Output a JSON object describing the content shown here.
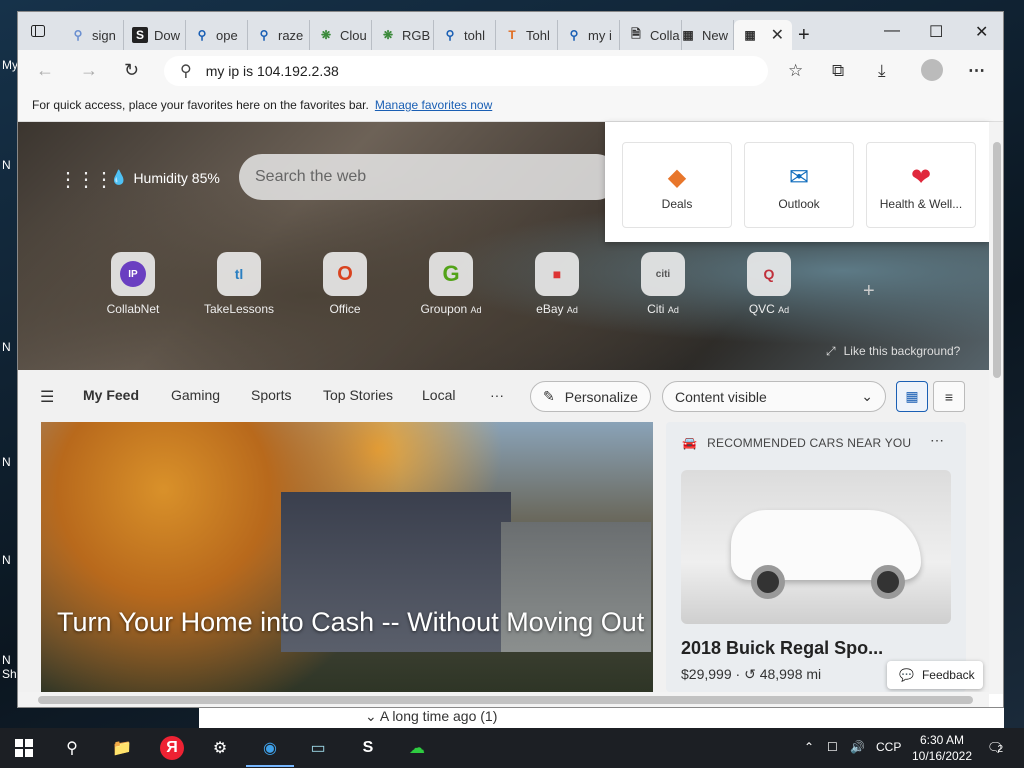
{
  "desktop": {
    "fragments": [
      "My",
      "N",
      "N",
      "N",
      "N",
      "N",
      "Sh"
    ]
  },
  "tabs": [
    {
      "label": "sign",
      "icon": "search-icon"
    },
    {
      "label": "Dow",
      "icon": "sharex-icon"
    },
    {
      "label": "ope",
      "icon": "search-icon"
    },
    {
      "label": "raze",
      "icon": "search-icon"
    },
    {
      "label": "Clou",
      "icon": "leaf-icon"
    },
    {
      "label": "RGB",
      "icon": "leaf-icon"
    },
    {
      "label": "tohl",
      "icon": "search-icon"
    },
    {
      "label": "Tohl",
      "icon": "t-logo-icon"
    },
    {
      "label": "my i",
      "icon": "search-icon"
    },
    {
      "label": "Colla",
      "icon": "page-icon"
    },
    {
      "label": "New",
      "icon": "newtab-icon"
    }
  ],
  "active_tab": {
    "icon": "newtab-icon"
  },
  "address_bar": {
    "value": "my ip is 104.192.2.38"
  },
  "favbar": {
    "text": "For quick access, place your favorites here on the favorites bar.",
    "link": "Manage favorites now"
  },
  "newtab": {
    "weather": "Humidity 85%",
    "search_placeholder": "Search the web",
    "quick_links": [
      {
        "label": "CollabNet",
        "glyph": "IP"
      },
      {
        "label": "TakeLessons",
        "glyph": "tl"
      },
      {
        "label": "Office",
        "glyph": "O"
      },
      {
        "label": "Groupon",
        "glyph": "G",
        "ad": "Ad"
      },
      {
        "label": "eBay",
        "glyph": "■",
        "ad": "Ad"
      },
      {
        "label": "Citi",
        "glyph": "citi",
        "ad": "Ad"
      },
      {
        "label": "QVC",
        "glyph": "Q",
        "ad": "Ad"
      }
    ],
    "like_background": "Like this background?",
    "flyout": [
      {
        "label": "Deals"
      },
      {
        "label": "Outlook"
      },
      {
        "label": "Health & Well..."
      }
    ]
  },
  "feed": {
    "tabs": [
      "My Feed",
      "Gaming",
      "Sports",
      "Top Stories",
      "Local"
    ],
    "more": "···",
    "personalize": "Personalize",
    "content_select": "Content visible",
    "main_story": "Turn Your Home into Cash -- Without Moving Out",
    "cars": {
      "header": "RECOMMENDED CARS NEAR YOU",
      "title": "2018 Buick Regal Spo...",
      "price": "$29,999",
      "mileage": "48,998 mi"
    },
    "feedback": "Feedback"
  },
  "behind_window": {
    "text": "A long time ago (1)"
  },
  "taskbar": {
    "lang": "CCP",
    "time": "6:30 AM",
    "date": "10/16/2022",
    "notifications": "2"
  },
  "colors": {
    "accent": "#1a5fb4",
    "taskbar": "#1c1f24"
  }
}
